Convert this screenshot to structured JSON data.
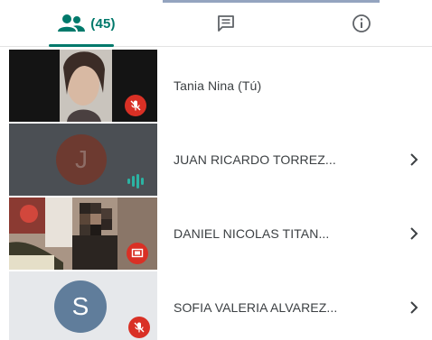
{
  "tabs": {
    "people_count": "(45)",
    "people_icon": "people-icon",
    "chat_icon": "chat-icon",
    "info_icon": "info-icon",
    "accent_color": "#00796b"
  },
  "participants": [
    {
      "name": "Tania Nina (Tú)",
      "status": "muted",
      "has_video": true
    },
    {
      "name": "JUAN RICARDO TORREZ...",
      "status": "speaking",
      "avatar_letter": "J",
      "has_video": false
    },
    {
      "name": "DANIEL NICOLAS TITAN...",
      "status": "screen-share",
      "has_video": true
    },
    {
      "name": "SOFIA VALERIA ALVAREZ...",
      "status": "muted",
      "avatar_letter": "S",
      "has_video": false
    }
  ],
  "colors": {
    "muted_badge": "#d93025",
    "speaking_indicator": "#1e8e8e",
    "avatar_s": "#607d9b",
    "avatar_j": "#6d3a30"
  }
}
